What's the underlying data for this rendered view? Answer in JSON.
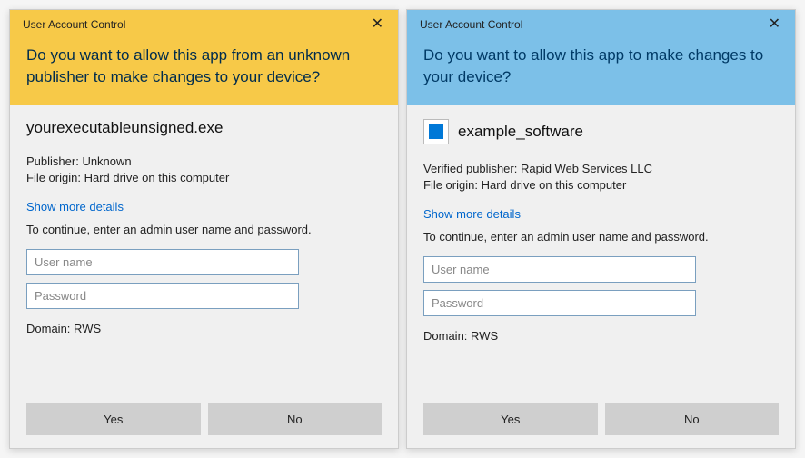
{
  "left": {
    "titlebar": "User Account Control",
    "heading": "Do you want to allow this app from an unknown publisher to make changes to your device?",
    "app_name": "yourexecutableunsigned.exe",
    "publisher_label": "Publisher:",
    "publisher_value": "Unknown",
    "origin_label": "File origin:",
    "origin_value": "Hard drive on this computer",
    "more_details": "Show more details",
    "instruction": "To continue, enter an admin user name and password.",
    "username_placeholder": "User name",
    "password_placeholder": "Password",
    "domain_label": "Domain:",
    "domain_value": "RWS",
    "yes": "Yes",
    "no": "No"
  },
  "right": {
    "titlebar": "User Account Control",
    "heading": "Do you want to allow this app to make changes to your device?",
    "app_name": "example_software",
    "publisher_label": "Verified publisher:",
    "publisher_value": "Rapid Web Services LLC",
    "origin_label": "File origin:",
    "origin_value": "Hard drive on this computer",
    "more_details": "Show more details",
    "instruction": "To continue, enter an admin user name and password.",
    "username_placeholder": "User name",
    "password_placeholder": "Password",
    "domain_label": "Domain:",
    "domain_value": "RWS",
    "yes": "Yes",
    "no": "No"
  }
}
